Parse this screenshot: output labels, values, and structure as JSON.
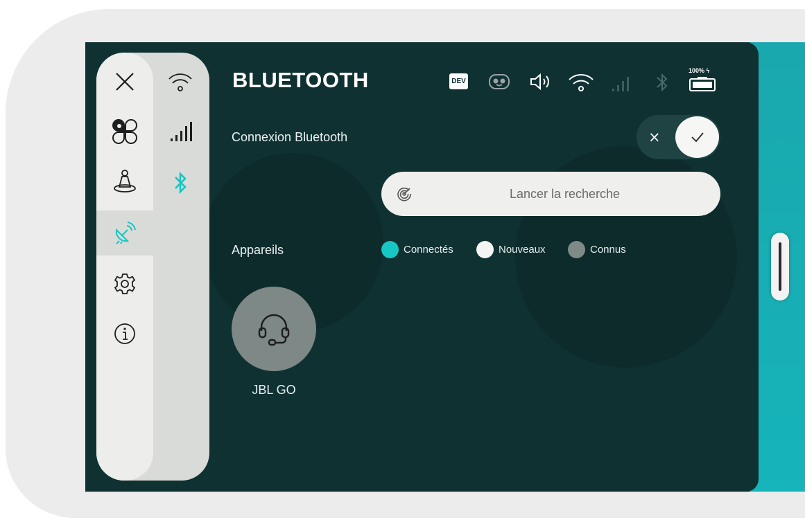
{
  "header": {
    "title": "BLUETOOTH",
    "dev_badge": "DEV",
    "battery_label": "100% ϟ",
    "status_icons": [
      "dev-badge",
      "robot-face-icon",
      "speaker-icon",
      "wifi-icon",
      "signal-icon",
      "bluetooth-icon",
      "battery-icon"
    ]
  },
  "sidebar": {
    "main_items": [
      {
        "name": "close",
        "icon": "close-icon"
      },
      {
        "name": "apps",
        "icon": "apps-grid-icon"
      },
      {
        "name": "robot",
        "icon": "robot-figure-icon"
      },
      {
        "name": "connectivity",
        "icon": "satellite-dish-icon",
        "active": true
      },
      {
        "name": "settings",
        "icon": "gear-icon"
      },
      {
        "name": "info",
        "icon": "info-icon"
      }
    ],
    "sub_items": [
      {
        "name": "wifi",
        "icon": "wifi-icon"
      },
      {
        "name": "cellular",
        "icon": "signal-bars-icon"
      },
      {
        "name": "bluetooth",
        "icon": "bluetooth-icon",
        "active": true
      }
    ]
  },
  "bluetooth": {
    "connection_label": "Connexion Bluetooth",
    "toggle_off_symbol": "×",
    "toggle_state": "on"
  },
  "search": {
    "label": "Lancer la recherche"
  },
  "devices": {
    "section_label": "Appareils",
    "legend": [
      {
        "label": "Connectés",
        "color": "#16c7c4"
      },
      {
        "label": "Nouveaux",
        "color": "#f4f4f4"
      },
      {
        "label": "Connus",
        "color": "#7d8a88"
      }
    ],
    "items": [
      {
        "name": "JBL GO",
        "icon": "headset-icon"
      }
    ]
  },
  "colors": {
    "accent": "#16c7c4",
    "background": "#0f3132",
    "sidebar": "#ededeb"
  }
}
